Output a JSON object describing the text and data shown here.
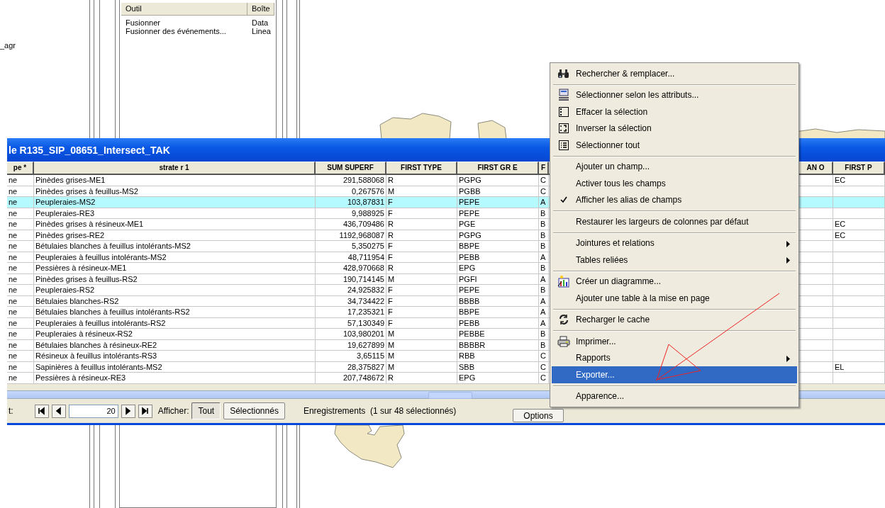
{
  "background": {
    "layer_label": "_agr"
  },
  "toolbox_window": {
    "columns": [
      "Outil",
      "Boîte"
    ],
    "rows": [
      {
        "tool": "Fusionner",
        "toolbox": "Data"
      },
      {
        "tool": "Fusionner des événements...",
        "toolbox": "Linea"
      }
    ]
  },
  "table_window": {
    "title": "le R135_SIP_08651_Intersect_TAK",
    "columns": [
      "pe *",
      "strate r 1",
      "SUM SUPERF",
      "FIRST TYPE",
      "FIRST GR E",
      "F",
      "AN O",
      "FIRST P"
    ],
    "rows": [
      {
        "selected": false,
        "pe": "ne",
        "strate": "Pinèdes grises-ME1",
        "sum": "291,588068",
        "type": "R",
        "gr": "PGPG",
        "f": "C",
        "first_p": "EC"
      },
      {
        "selected": false,
        "pe": "ne",
        "strate": "Pinèdes grises à feuillus-MS2",
        "sum": "0,267576",
        "type": "M",
        "gr": "PGBB",
        "f": "C"
      },
      {
        "selected": true,
        "pe": "ne",
        "strate": "Peupleraies-MS2",
        "sum": "103,87831",
        "type": "F",
        "gr": "PEPE",
        "f": "A"
      },
      {
        "selected": false,
        "pe": "ne",
        "strate": "Peupleraies-RE3",
        "sum": "9,988925",
        "type": "F",
        "gr": "PEPE",
        "f": "B"
      },
      {
        "selected": false,
        "pe": "ne",
        "strate": "Pinèdes grises à résineux-ME1",
        "sum": "436,709486",
        "type": "R",
        "gr": "PGE",
        "f": "B",
        "first_p": "EC"
      },
      {
        "selected": false,
        "pe": "ne",
        "strate": "Pinèdes grises-RE2",
        "sum": "1192,968087",
        "type": "R",
        "gr": "PGPG",
        "f": "B",
        "first_p": "EC"
      },
      {
        "selected": false,
        "pe": "ne",
        "strate": "Bétulaies blanches à feuillus intolérants-MS2",
        "sum": "5,350275",
        "type": "F",
        "gr": "BBPE",
        "f": "B"
      },
      {
        "selected": false,
        "pe": "ne",
        "strate": "Peupleraies à feuillus intolérants-MS2",
        "sum": "48,711954",
        "type": "F",
        "gr": "PEBB",
        "f": "A"
      },
      {
        "selected": false,
        "pe": "ne",
        "strate": "Pessières à résineux-ME1",
        "sum": "428,970668",
        "type": "R",
        "gr": "EPG",
        "f": "B"
      },
      {
        "selected": false,
        "pe": "ne",
        "strate": "Pinèdes grises à feuillus-RS2",
        "sum": "190,714145",
        "type": "M",
        "gr": "PGFI",
        "f": "A"
      },
      {
        "selected": false,
        "pe": "ne",
        "strate": "Peupleraies-RS2",
        "sum": "24,925832",
        "type": "F",
        "gr": "PEPE",
        "f": "B"
      },
      {
        "selected": false,
        "pe": "ne",
        "strate": "Bétulaies blanches-RS2",
        "sum": "34,734422",
        "type": "F",
        "gr": "BBBB",
        "f": "A"
      },
      {
        "selected": false,
        "pe": "ne",
        "strate": "Bétulaies blanches à feuillus intolérants-RS2",
        "sum": "17,235321",
        "type": "F",
        "gr": "BBPE",
        "f": "A"
      },
      {
        "selected": false,
        "pe": "ne",
        "strate": "Peupleraies à feuillus intolérants-RS2",
        "sum": "57,130349",
        "type": "F",
        "gr": "PEBB",
        "f": "A"
      },
      {
        "selected": false,
        "pe": "ne",
        "strate": "Peupleraies à résineux-RS2",
        "sum": "103,980201",
        "type": "M",
        "gr": "PEBBE",
        "f": "B"
      },
      {
        "selected": false,
        "pe": "ne",
        "strate": "Bétulaies blanches à résineux-RE2",
        "sum": "19,627899",
        "type": "M",
        "gr": "BBBBR",
        "f": "B"
      },
      {
        "selected": false,
        "pe": "ne",
        "strate": "Résineux à feuillus intolérants-RS3",
        "sum": "3,65115",
        "type": "M",
        "gr": "RBB",
        "f": "C"
      },
      {
        "selected": false,
        "pe": "ne",
        "strate": "Sapinières à feuillus intolérants-MS2",
        "sum": "28,375827",
        "type": "M",
        "gr": "SBB",
        "f": "C",
        "first_p": "EL"
      },
      {
        "selected": false,
        "pe": "ne",
        "strate": "Pessières à résineux-RE3",
        "sum": "207,748672",
        "type": "R",
        "gr": "EPG",
        "f": "C"
      }
    ],
    "toolbar": {
      "record_label": "t:",
      "record_value": "20",
      "show_label": "Afficher:",
      "show_buttons": [
        {
          "label": "Tout",
          "selected": true
        },
        {
          "label": "Sélectionnés",
          "selected": false
        }
      ],
      "records_status": "Enregistrements  (1 sur 48 sélectionnés)",
      "options_button": "Options"
    }
  },
  "context_menu": {
    "groups": [
      [
        {
          "label": "Rechercher & remplacer...",
          "kind": "search",
          "checked": false,
          "submenu": false,
          "selected": false
        }
      ],
      [
        {
          "label": "Sélectionner selon les attributs...",
          "kind": "sql",
          "checked": false,
          "submenu": false,
          "selected": false
        },
        {
          "label": "Effacer la sélection",
          "kind": "clear",
          "checked": false,
          "submenu": false,
          "selected": false
        },
        {
          "label": "Inverser la sélection",
          "kind": "invert",
          "checked": false,
          "submenu": false,
          "selected": false
        },
        {
          "label": "Sélectionner tout",
          "kind": "select_all",
          "checked": false,
          "submenu": false,
          "selected": false
        }
      ],
      [
        {
          "label": "Ajouter un champ...",
          "kind": "plain",
          "checked": false,
          "submenu": false,
          "selected": false
        },
        {
          "label": "Activer tous les champs",
          "kind": "plain",
          "checked": false,
          "submenu": false,
          "selected": false
        },
        {
          "label": "Afficher les alias de champs",
          "kind": "plain",
          "checked": true,
          "submenu": false,
          "selected": false
        }
      ],
      [
        {
          "label": "Restaurer les largeurs de colonnes par défaut",
          "kind": "plain",
          "checked": false,
          "submenu": false,
          "selected": false
        }
      ],
      [
        {
          "label": "Jointures et relations",
          "kind": "plain",
          "checked": false,
          "submenu": true,
          "selected": false
        },
        {
          "label": "Tables reliées",
          "kind": "plain",
          "checked": false,
          "submenu": true,
          "selected": false
        }
      ],
      [
        {
          "label": "Créer un diagramme...",
          "kind": "chart",
          "checked": false,
          "submenu": false,
          "selected": false
        },
        {
          "label": "Ajouter une table à la mise en page",
          "kind": "plain",
          "checked": false,
          "submenu": false,
          "selected": false
        }
      ],
      [
        {
          "label": "Recharger le cache",
          "kind": "reload",
          "checked": false,
          "submenu": false,
          "selected": false
        }
      ],
      [
        {
          "label": "Imprimer...",
          "kind": "print",
          "checked": false,
          "submenu": false,
          "selected": false
        },
        {
          "label": "Rapports",
          "kind": "plain",
          "checked": false,
          "submenu": true,
          "selected": false
        },
        {
          "label": "Exporter...",
          "kind": "plain",
          "checked": false,
          "submenu": false,
          "selected": true
        }
      ],
      [
        {
          "label": "Apparence...",
          "kind": "plain",
          "checked": false,
          "submenu": false,
          "selected": false
        }
      ]
    ]
  }
}
